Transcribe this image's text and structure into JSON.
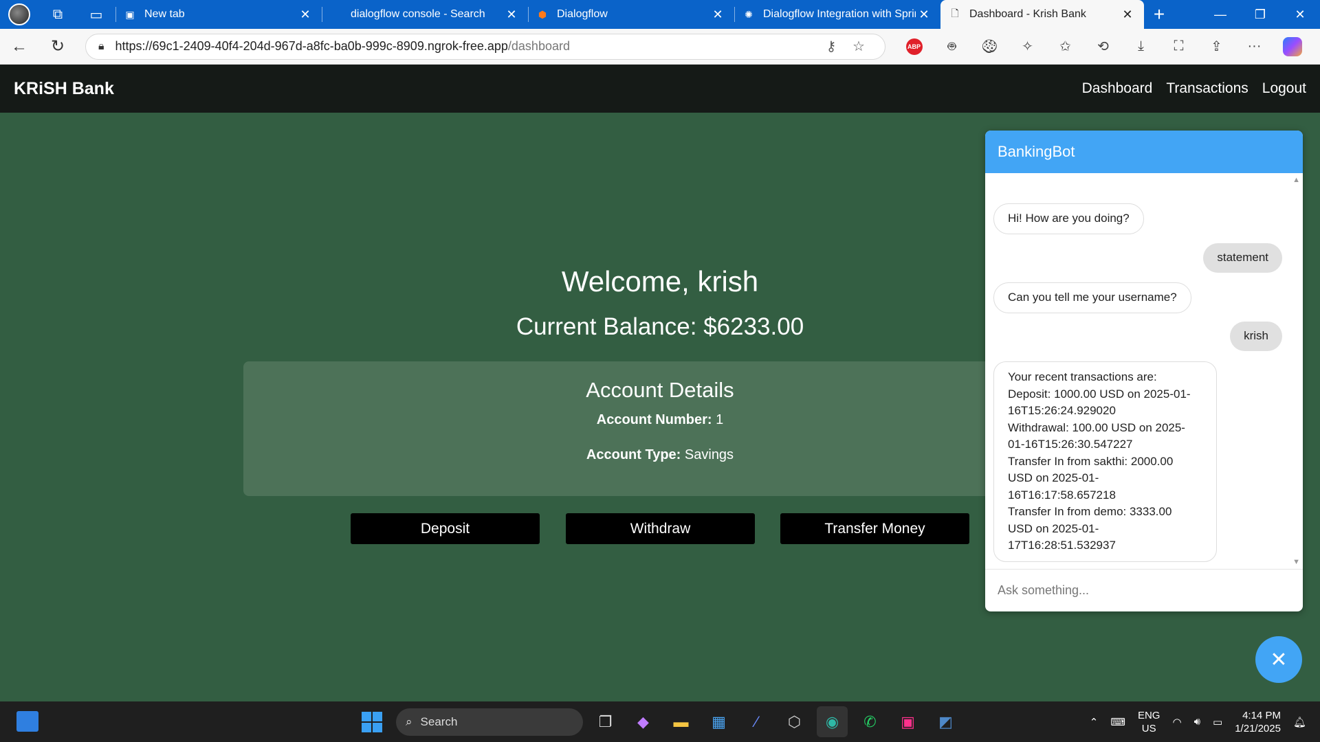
{
  "browser": {
    "tabs": [
      {
        "title": "New tab",
        "icon": "new-tab-icon",
        "active": false
      },
      {
        "title": "dialogflow console - Search",
        "icon": "search-icon",
        "active": false
      },
      {
        "title": "Dialogflow",
        "icon": "dialogflow-icon",
        "active": false
      },
      {
        "title": "Dialogflow Integration with Sprin",
        "icon": "chatgpt-icon",
        "active": false
      },
      {
        "title": "Dashboard - Krish Bank",
        "icon": "page-icon",
        "active": true
      }
    ],
    "url_host": "https://69c1-2409-40f4-204d-967d-a8fc-ba0b-999c-8909.ngrok-free.app",
    "url_path": "/dashboard",
    "extension_abp_label": "ABP"
  },
  "app": {
    "brand": "KRiSH Bank",
    "nav": [
      "Dashboard",
      "Transactions",
      "Logout"
    ],
    "welcome": "Welcome, krish",
    "balance": "Current Balance: $6233.00",
    "account": {
      "heading": "Account Details",
      "number_label": "Account Number:",
      "number_value": "1",
      "type_label": "Account Type:",
      "type_value": "Savings"
    },
    "buttons": [
      "Deposit",
      "Withdraw",
      "Transfer Money"
    ]
  },
  "chatbot": {
    "title": "BankingBot",
    "messages": [
      {
        "from": "bot",
        "text": "Hi! How are you doing?"
      },
      {
        "from": "user",
        "text": "statement"
      },
      {
        "from": "bot",
        "text": "Can you tell me your username?"
      },
      {
        "from": "user",
        "text": "krish"
      },
      {
        "from": "bot",
        "lines": [
          "Your recent transactions are:",
          "Deposit: 1000.00 USD on 2025-01-",
          "16T15:26:24.929020",
          "Withdrawal: 100.00 USD on 2025-",
          "01-16T15:26:30.547227",
          "Transfer In from sakthi: 2000.00",
          "USD on 2025-01-",
          "16T16:17:58.657218",
          "Transfer In from demo: 3333.00",
          "USD on 2025-01-",
          "17T16:28:51.532937"
        ]
      }
    ],
    "input_placeholder": "Ask something...",
    "close_label": "✕"
  },
  "taskbar": {
    "search_label": "Search",
    "lang_line1": "ENG",
    "lang_line2": "US",
    "time": "4:14 PM",
    "date": "1/21/2025"
  }
}
